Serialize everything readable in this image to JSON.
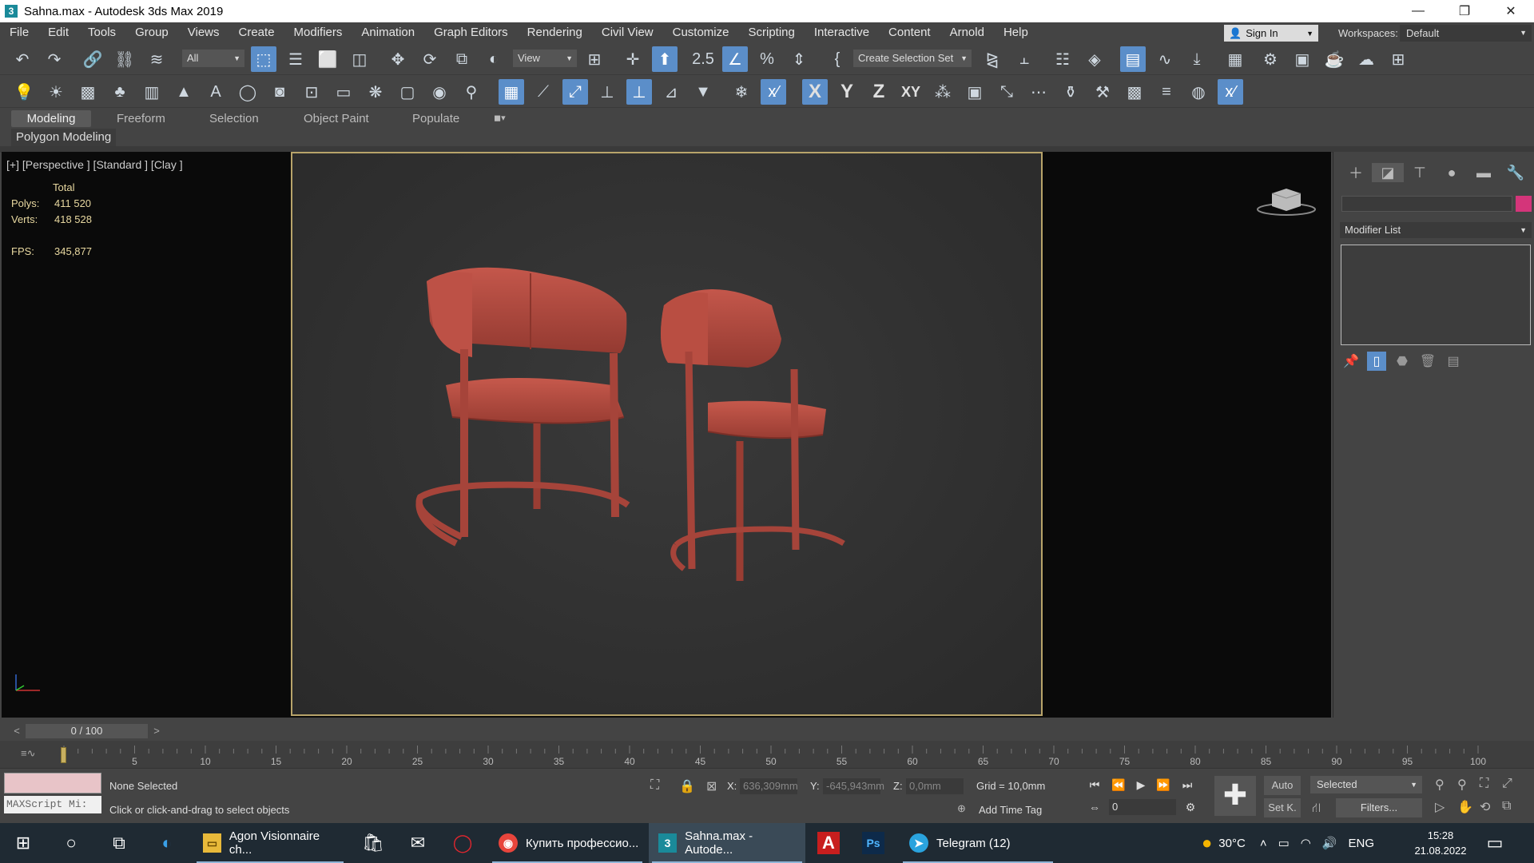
{
  "window": {
    "title": "Sahna.max - Autodesk 3ds Max 2019",
    "minimize": "—",
    "restore": "❐",
    "close": "✕"
  },
  "menu": [
    "File",
    "Edit",
    "Tools",
    "Group",
    "Views",
    "Create",
    "Modifiers",
    "Animation",
    "Graph Editors",
    "Rendering",
    "Civil View",
    "Customize",
    "Scripting",
    "Interactive",
    "Content",
    "Arnold",
    "Help"
  ],
  "account": {
    "sign_in": "Sign In",
    "workspaces_label": "Workspaces:",
    "workspace": "Default"
  },
  "toolbar": {
    "selection_filter": "All",
    "ref_coord": "View",
    "selection_set": "Create Selection Set"
  },
  "ribbon": {
    "tabs": [
      "Modeling",
      "Freeform",
      "Selection",
      "Object Paint",
      "Populate"
    ],
    "sub_panel": "Polygon Modeling"
  },
  "viewport": {
    "label": "[+] [Perspective ] [Standard ] [Clay ]",
    "stats_header": "Total",
    "polys_label": "Polys:",
    "polys": "411 520",
    "verts_label": "Verts:",
    "verts": "418 528",
    "fps_label": "FPS:",
    "fps": "345,877",
    "object_color": "#b34a3f"
  },
  "command_panel": {
    "modifier_list": "Modifier List",
    "object_color": "#d4357a"
  },
  "timeline": {
    "frame": "0 / 100",
    "ticks": [
      "5",
      "10",
      "15",
      "20",
      "25",
      "30",
      "35",
      "40",
      "45",
      "50",
      "55",
      "60",
      "65",
      "70",
      "75",
      "80",
      "85",
      "90",
      "95",
      "100"
    ]
  },
  "status": {
    "maxscript": "MAXScript Mi:",
    "selection": "None Selected",
    "prompt": "Click or click-and-drag to select objects",
    "x_label": "X:",
    "x_value": "636,309mm",
    "y_label": "Y:",
    "y_value": "-645,943mm",
    "z_label": "Z:",
    "z_value": "0,0mm",
    "grid": "Grid = 10,0mm",
    "add_time_tag": "Add Time Tag",
    "auto": "Auto",
    "set_key": "Set K.",
    "key_filter": "Selected",
    "filters": "Filters...",
    "frame_field": "0"
  },
  "taskbar": {
    "apps": [
      {
        "label": "Agon Visionnaire ch...",
        "icon": "folder-icon"
      },
      {
        "label": "Купить профессио...",
        "icon": "chrome-icon"
      },
      {
        "label": "Sahna.max - Autode...",
        "icon": "3dsmax-icon"
      },
      {
        "label": "Telegram (12)",
        "icon": "telegram-icon"
      }
    ],
    "temperature": "30°C",
    "language": "ENG",
    "time": "15:28",
    "date": "21.08.2022"
  }
}
